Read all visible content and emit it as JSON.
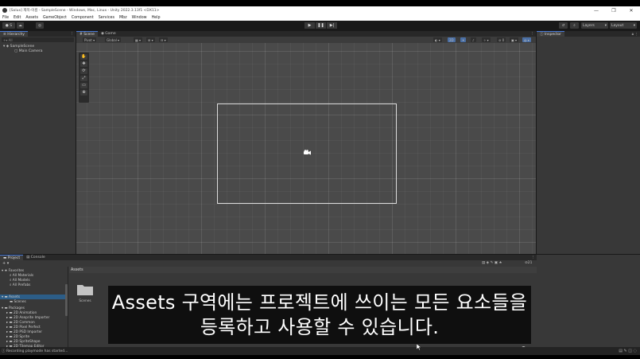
{
  "window": {
    "title": "[Solux] 제목-이름 - SampleScene - Windows, Mac, Linux - Unity 2022.3.13f1 <DX11>",
    "controls": [
      "—",
      "❐",
      "✕"
    ]
  },
  "menu": [
    "File",
    "Edit",
    "Assets",
    "GameObject",
    "Component",
    "Services",
    "Mbz",
    "Window",
    "Help"
  ],
  "toolbar": {
    "account_label": "S",
    "layers_label": "Layers",
    "layout_label": "Layout"
  },
  "hierarchy": {
    "tab": "Hierarchy",
    "search_placeholder": "All",
    "scene": "SampleScene",
    "items": [
      "Main Camera"
    ]
  },
  "scene_view": {
    "tabs": [
      "Scene",
      "Game"
    ],
    "pivot_label": "Pivot",
    "global_label": "Global",
    "mode_2d": "2D",
    "tool_labels": [
      "✋",
      "✥",
      "⟳",
      "⤢",
      "▭",
      "⊕"
    ]
  },
  "inspector": {
    "tab": "Inspector"
  },
  "project": {
    "tabs": [
      "Project",
      "Console"
    ],
    "favorites_label": "Favorites",
    "favorites": [
      "All Materials",
      "All Models",
      "All Prefabs"
    ],
    "assets_label": "Assets",
    "assets_children": [
      "Scenes"
    ],
    "packages_label": "Packages",
    "packages": [
      "2D Animation",
      "2D Aseprite Importer",
      "2D Common",
      "2D Pixel Perfect",
      "2D PSD Importer",
      "2D Sprite",
      "2D SpriteShape",
      "2D Tilemap Editor"
    ],
    "breadcrumb": "Assets",
    "folder_name": "Scenes",
    "count_badge": "21"
  },
  "status": {
    "message": "Recording playmode has started..."
  },
  "subtitle": {
    "line1": "Assets 구역에는 프로젝트에 쓰이는 모든 요소들을",
    "line2": "등록하고 사용할 수 있습니다."
  }
}
